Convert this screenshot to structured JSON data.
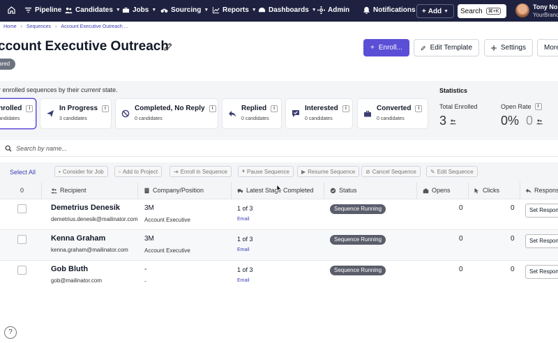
{
  "nav": {
    "items": [
      {
        "label": "Pipeline",
        "icon": "filter-icon"
      },
      {
        "label": "Candidates",
        "icon": "users-icon"
      },
      {
        "label": "Jobs",
        "icon": "briefcase-icon"
      },
      {
        "label": "Sourcing",
        "icon": "binoculars-icon"
      },
      {
        "label": "Reports",
        "icon": "chart-icon"
      },
      {
        "label": "Dashboards",
        "icon": "gauge-icon"
      },
      {
        "label": "Admin",
        "icon": "gear-icon"
      },
      {
        "label": "Notifications",
        "icon": "bell-icon"
      }
    ],
    "add_label": "Add",
    "search_label": "Search",
    "search_shortcut": "⌘+K",
    "user_name": "Tony Nob",
    "user_org": "YourBrand"
  },
  "breadcrumb": [
    "Home",
    "Sequences",
    "Account Executive Outreach ..."
  ],
  "page": {
    "title": "ccount Executive Outreach",
    "badge": "ared",
    "enroll_label": "Enroll...",
    "edit_template_label": "Edit Template",
    "settings_label": "Settings",
    "more_label": "More"
  },
  "filter_hint": {
    "prefix": "r enrolled sequences by their ",
    "emph": "current",
    "suffix": " state."
  },
  "state_cards": [
    {
      "label": "nrolled",
      "sub": "andidates",
      "selected": true
    },
    {
      "label": "In Progress",
      "sub": "3 candidates",
      "icon": "send-icon"
    },
    {
      "label": "Completed, No Reply",
      "sub": "0 candidates",
      "icon": "ban-icon"
    },
    {
      "label": "Replied",
      "sub": "0 candidates",
      "icon": "reply-icon"
    },
    {
      "label": "Interested",
      "sub": "0 candidates",
      "icon": "chat-check-icon"
    },
    {
      "label": "Converted",
      "sub": "0 candidates",
      "icon": "briefcase-icon"
    }
  ],
  "statistics": {
    "heading": "Statistics",
    "total_enrolled_label": "Total Enrolled",
    "total_enrolled_value": "3",
    "open_rate_label": "Open Rate",
    "open_rate_value": "0%",
    "open_rate_count": "0"
  },
  "search_placeholder": "Search by name...",
  "actions": {
    "select_all": "Select All",
    "buttons": [
      "Consider for Job",
      "Add to Project",
      "Enroll in Sequence",
      "Pause Sequence",
      "Resume Sequence",
      "Cancel Sequence",
      "Edit Sequence"
    ]
  },
  "table": {
    "selected_count": "0",
    "columns": [
      "Recipient",
      "Company/Position",
      "Latest Stage Completed",
      "Status",
      "Opens",
      "Clicks",
      "Response"
    ],
    "rows": [
      {
        "name": "Demetrius Denesik",
        "email": "demetrius.denesik@mailinator.com",
        "company": "3M",
        "position": "Account Executive",
        "stage": "1 of 3",
        "step": "Email",
        "status": "Sequence Running",
        "opens": "0",
        "clicks": "0",
        "action": "Set Response"
      },
      {
        "name": "Kenna Graham",
        "email": "kenna.graham@mailinator.com",
        "company": "3M",
        "position": "Account Executive",
        "stage": "1 of 3",
        "step": "Email",
        "status": "Sequence Running",
        "opens": "0",
        "clicks": "0",
        "action": "Set Response"
      },
      {
        "name": "Gob Bluth",
        "email": "gob@mailinator.com",
        "company": "-",
        "position": "-",
        "stage": "1 of 3",
        "step": "Email",
        "status": "Sequence Running",
        "opens": "0",
        "clicks": "0",
        "action": "Set Response"
      }
    ]
  },
  "help_label": "?",
  "colors": {
    "nav_bg": "#1e2240",
    "accent": "#5b4fd6",
    "status_bg": "#5a5e6b"
  }
}
